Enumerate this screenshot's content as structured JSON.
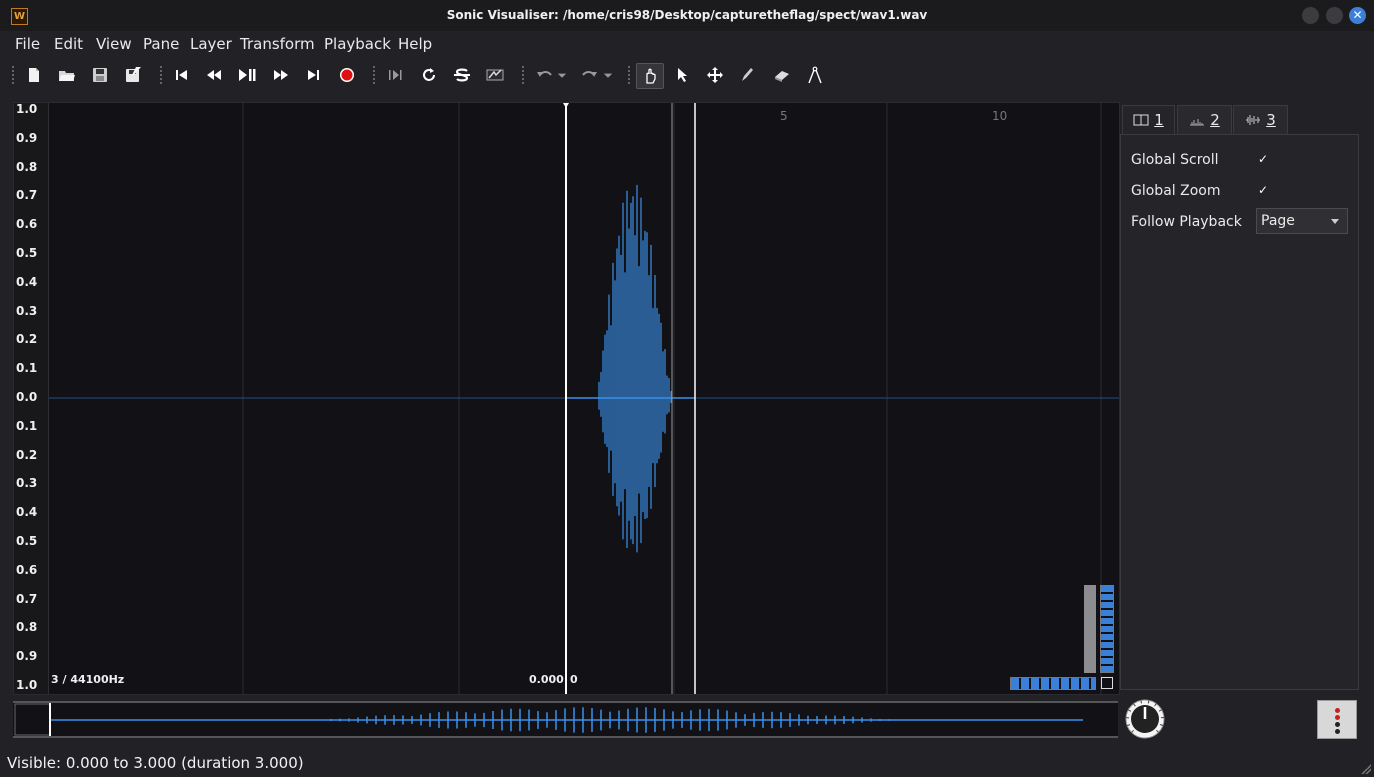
{
  "window": {
    "title": "Sonic Visualiser: /home/cris98/Desktop/capturetheflag/spect/wav1.wav",
    "app_icon_letter": "W"
  },
  "menu": [
    "File",
    "Edit",
    "View",
    "Pane",
    "Layer",
    "Transform",
    "Playback",
    "Help"
  ],
  "toolbar": {
    "icons": [
      "new-file-icon",
      "open-file-icon",
      "save-icon",
      "save-as-icon",
      "rewind-start-icon",
      "rewind-icon",
      "play-pause-icon",
      "fast-forward-icon",
      "fast-forward-end-icon",
      "record-icon",
      "constrain-playback-icon",
      "loop-icon",
      "solo-icon",
      "speed-icon",
      "undo-icon",
      "redo-icon",
      "navigate-icon",
      "select-icon",
      "move-icon",
      "draw-icon",
      "erase-icon",
      "measure-icon"
    ],
    "active_tool": "navigate-icon",
    "record_color": "#e01010"
  },
  "pane": {
    "scale_labels": [
      "1.0",
      "0.9",
      "0.8",
      "0.7",
      "0.6",
      "0.5",
      "0.4",
      "0.3",
      "0.2",
      "0.1",
      "0.0",
      "0.1",
      "0.2",
      "0.3",
      "0.4",
      "0.5",
      "0.6",
      "0.7",
      "0.8",
      "0.9",
      "1.0"
    ],
    "rate": "3 / 44100Hz",
    "position": "0.000",
    "frame": "0",
    "ruler_ticks": [
      "5",
      "10"
    ],
    "waveform_color": "#3a8fe8"
  },
  "properties": {
    "tabs": [
      {
        "label": "1",
        "icon": "pane-icon"
      },
      {
        "label": "2",
        "icon": "spectrum-icon"
      },
      {
        "label": "3",
        "icon": "waveform-icon"
      }
    ],
    "global_scroll_label": "Global Scroll",
    "global_scroll_checked": true,
    "global_zoom_label": "Global Zoom",
    "global_zoom_checked": true,
    "follow_playback_label": "Follow Playback",
    "follow_playback_value": "Page"
  },
  "status": {
    "text": "Visible: 0.000 to 3.000 (duration 3.000)"
  }
}
